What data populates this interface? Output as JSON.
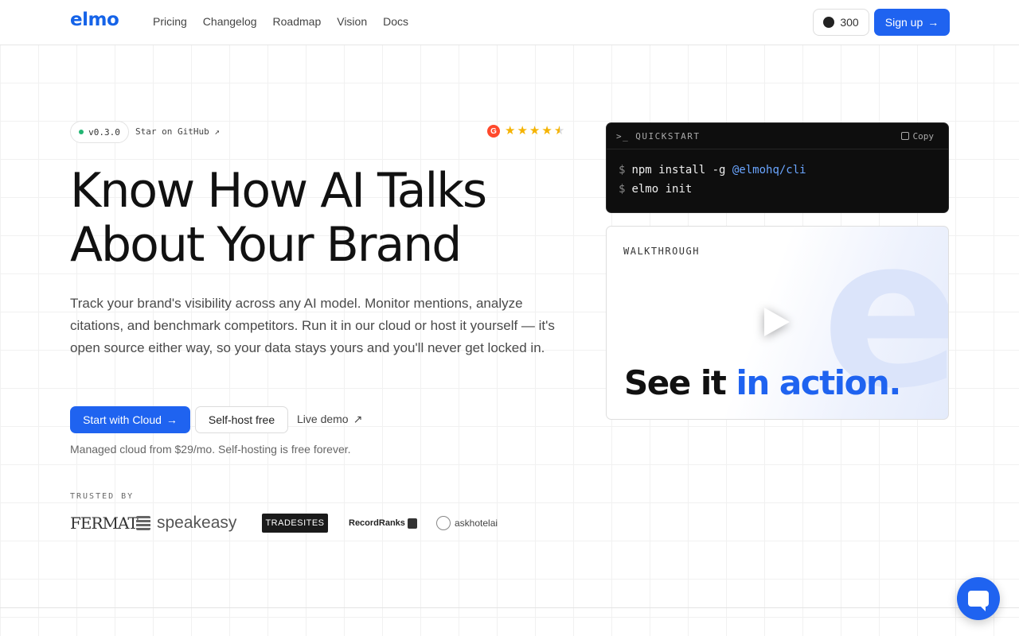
{
  "header": {
    "logo": "elmo",
    "nav": [
      "Pricing",
      "Changelog",
      "Roadmap",
      "Vision",
      "Docs"
    ],
    "github_count": "300",
    "signup_label": "Sign up"
  },
  "hero": {
    "version": "v0.3.0",
    "star_github": "Star on GitHub ↗",
    "rating_icon": "G",
    "title_line1": "Know How AI Talks",
    "title_line2": "About Your Brand",
    "description": "Track your brand's visibility across any AI model. Monitor mentions, analyze citations, and benchmark competitors. Run it in our cloud or host it yourself — it's open source either way, so your data stays yours and you'll never get locked in.",
    "cta_cloud": "Start with Cloud",
    "cta_selfhost": "Self-host free",
    "cta_demo": "Live demo",
    "managed_note": "Managed cloud from $29/mo. Self-hosting is free forever."
  },
  "trusted": {
    "label": "TRUSTED BY",
    "logos": [
      "FERMAT",
      "speakeasy",
      "TRADESITES",
      "RecordRanks",
      "askhotelai"
    ]
  },
  "quickstart": {
    "title": "QUICKSTART",
    "prompt_icon": ">_",
    "copy_label": "Copy",
    "line1_cmd": "npm install -g ",
    "line1_pkg": "@elmohq/cli",
    "line2_cmd": "elmo init"
  },
  "walkthrough": {
    "label": "WALKTHROUGH",
    "heading_plain": "See it ",
    "heading_accent": "in action."
  },
  "colors": {
    "brand": "#1f63f0",
    "github_dot": "#22b573",
    "star": "#f5b301"
  },
  "icons": [
    "github-icon",
    "arrow-right-icon",
    "arrow-up-right-icon",
    "g2-icon",
    "star-icon",
    "terminal-icon",
    "copy-icon",
    "play-icon",
    "chat-icon"
  ]
}
